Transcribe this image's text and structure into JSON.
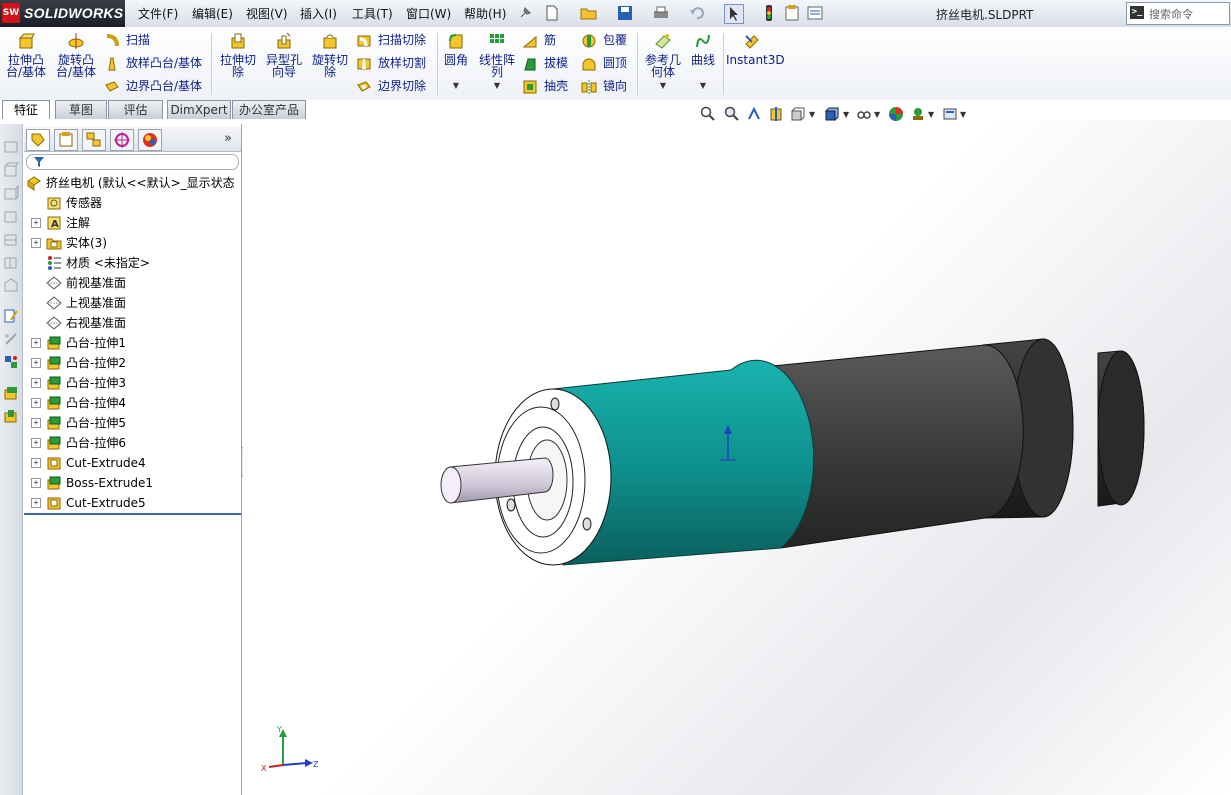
{
  "app": {
    "logo_text": "SOLIDWORKS",
    "logo_mark": "SW"
  },
  "menu": [
    "文件(F)",
    "编辑(E)",
    "视图(V)",
    "插入(I)",
    "工具(T)",
    "窗口(W)",
    "帮助(H)"
  ],
  "document_title": "挤丝电机.SLDPRT",
  "search": {
    "placeholder": "搜索命令",
    "icon_glyph": ">_"
  },
  "command_manager": {
    "big_buttons": [
      {
        "label1": "拉伸凸",
        "label2": "台/基体"
      },
      {
        "label1": "旋转凸",
        "label2": "台/基体"
      },
      {
        "label1": "拉伸切",
        "label2": "除"
      },
      {
        "label1": "异型孔",
        "label2": "向导"
      },
      {
        "label1": "旋转切",
        "label2": "除"
      },
      {
        "label1": "圆角",
        "label2": ""
      },
      {
        "label1": "线性阵",
        "label2": "列"
      },
      {
        "label1": "参考几",
        "label2": "何体"
      },
      {
        "label1": "曲线",
        "label2": ""
      },
      {
        "label1": "Instant3D",
        "label2": ""
      }
    ],
    "small_buttons": {
      "sweep": "扫描",
      "loft": "放样凸台/基体",
      "boundary": "边界凸台/基体",
      "sweep_cut": "扫描切除",
      "loft_cut": "放样切割",
      "boundary_cut": "边界切除",
      "rib": "筋",
      "draft": "拔模",
      "shell": "抽壳",
      "wrap": "包覆",
      "dome": "圆顶",
      "mirror": "镜向"
    }
  },
  "tabs": [
    "特征",
    "草图",
    "评估",
    "DimXpert",
    "办公室产品"
  ],
  "panel": {
    "more": "»"
  },
  "tree": {
    "root": "挤丝电机 (默认<<默认>_显示状态",
    "items": [
      "传感器",
      "注解",
      "实体(3)",
      "材质 <未指定>",
      "前视基准面",
      "上视基准面",
      "右视基准面",
      "凸台-拉伸1",
      "凸台-拉伸2",
      "凸台-拉伸3",
      "凸台-拉伸4",
      "凸台-拉伸5",
      "凸台-拉伸6",
      "Cut-Extrude4",
      "Boss-Extrude1",
      "Cut-Extrude5"
    ]
  },
  "triad": {
    "x": "X",
    "y": "Y",
    "z": "Z"
  },
  "colors": {
    "teal_body": "#0f8f8c",
    "dark_body": "#404040",
    "accent_blue": "#0b1f8a"
  }
}
